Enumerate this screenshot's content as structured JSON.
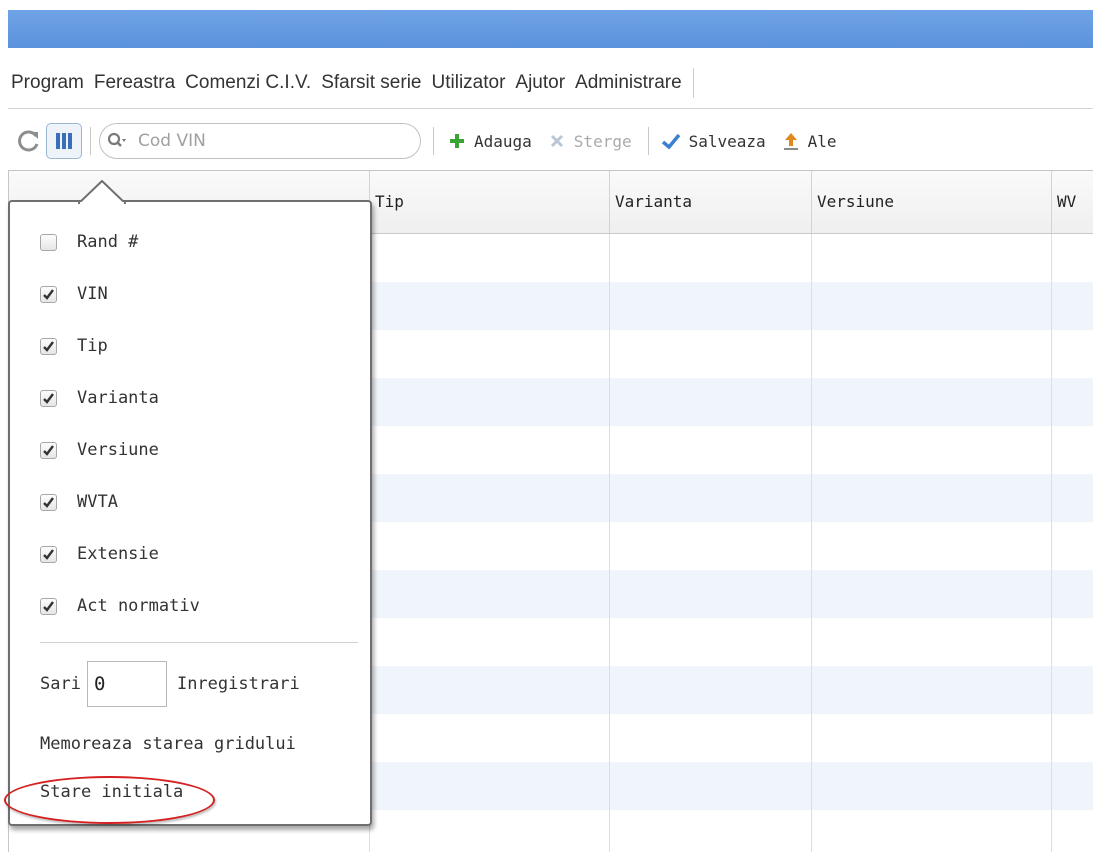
{
  "menubar": {
    "items": [
      "Program",
      "Fereastra",
      "Comenzi C.I.V.",
      "Sfarsit serie",
      "Utilizator",
      "Ajutor",
      "Administrare"
    ]
  },
  "toolbar": {
    "search_placeholder": "Cod VIN",
    "add_label": "Adauga",
    "delete_label": "Sterge",
    "save_label": "Salveaza",
    "upload_label": "Ale"
  },
  "grid": {
    "columns": [
      "Tip",
      "Varianta",
      "Versiune",
      "WV"
    ]
  },
  "column_menu": {
    "items": [
      {
        "label": "Rand #",
        "checked": false
      },
      {
        "label": "VIN",
        "checked": true
      },
      {
        "label": "Tip",
        "checked": true
      },
      {
        "label": "Varianta",
        "checked": true
      },
      {
        "label": "Versiune",
        "checked": true
      },
      {
        "label": "WVTA",
        "checked": true
      },
      {
        "label": "Extensie",
        "checked": true
      },
      {
        "label": "Act normativ",
        "checked": true
      }
    ],
    "skip_label": "Sari",
    "skip_value": "0",
    "records_label": "Inregistrari",
    "save_state_label": "Memoreaza starea gridului",
    "reset_label": "Stare initiala"
  },
  "colors": {
    "titlebar": "#5b92dc",
    "highlight": "#d42020",
    "add_icon": "#3aa335",
    "save_icon": "#3a82d0"
  }
}
